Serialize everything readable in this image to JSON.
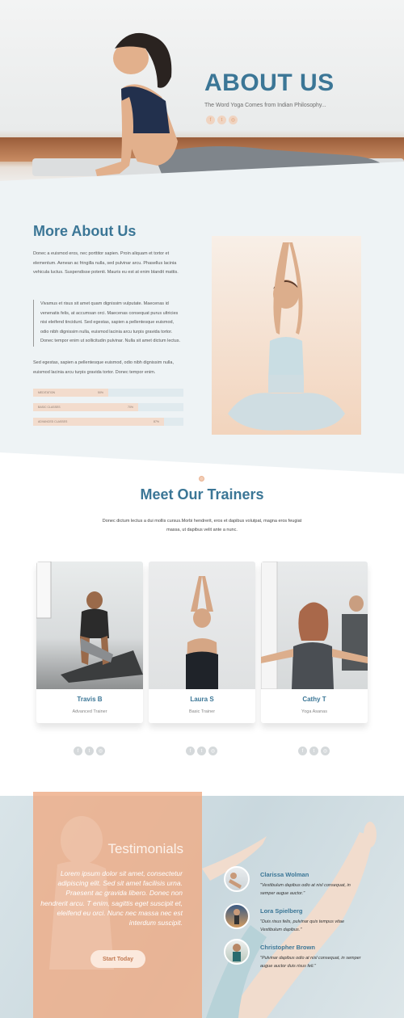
{
  "hero": {
    "title": "ABOUT US",
    "subtitle": "The Word Yoga Comes from Indian Philosophy...",
    "social_icons": [
      "facebook-icon",
      "twitter-icon",
      "instagram-icon"
    ]
  },
  "about": {
    "title": "More About Us",
    "paragraph1": "Donec a euismod eros, nec porttitor sapien. Proin aliquam et tortor et elementum. Aenean ac fringilla nulla, sed pulvinar arcu. Phasellus lacinia vehicula luctus. Suspendisse potenti. Mauris eu est at enim blandit mattis.",
    "quote": "Vivamus et risus sit amet quam dignissim vulputate. Maecenas id venenatis felis, at accumsan orci. Maecenas consequat purus ultricies nisi eleifend tincidunt. Sed egestas, sapien a pellentesque euismod, odio nibh dignissim nulla, euismod lacinia arcu turpis gravida tortor. Donec tempor enim ut sollicitudin pulvinar. Nulla sit amet dictum lectus.",
    "paragraph2": "Sed egestas, sapien a pellentesque euismod, odio nibh dignissim nulla, euismod lacinia arcu turpis gravida tortor. Donec tempor enim.",
    "skills": [
      {
        "label": "Meditation",
        "percent_text": "50%",
        "value": 0.5
      },
      {
        "label": "Basic Classes",
        "percent_text": "70%",
        "value": 0.7
      },
      {
        "label": "Advanced Classes",
        "percent_text": "87%",
        "value": 0.87
      }
    ]
  },
  "trainers": {
    "title": "Meet Our Trainers",
    "description": "Donec dictum lectus a dui mollis cursus.Morbi hendrerit, eros et dapibus volutpat, magna eros feugiat massa, ut dapibus velit ante a nunc.",
    "items": [
      {
        "name": "Travis B",
        "role": "Advanced Trainer"
      },
      {
        "name": "Laura S",
        "role": "Basic Trainer"
      },
      {
        "name": "Cathy T",
        "role": "Yoga Asanas"
      }
    ]
  },
  "testimonials": {
    "title": "Testimonials",
    "text": "Lorem ipsum dolor sit amet, consectetur adipiscing elit. Sed sit amet facilisis urna. Praesent ac gravida libero. Donec non hendrerit arcu. T enim, sagittis eget suscipit et, eleifend eu orci. Nunc nec massa nec est interdum suscipit.",
    "button": "Start Today",
    "reviews": [
      {
        "name": "Clarissa Wolman",
        "text": "\"Vestibulum dapibus odio at nisl consequat, in semper augue auctor.\""
      },
      {
        "name": "Lora Spielberg",
        "text": "\"Duis risus felis, pulvinar quis tempus vitae Vestibulum dapibus.\""
      },
      {
        "name": "Christopher Brown",
        "text": "\"Pulvinar dapibus odio at nisl consequat, in semper augue auctor duis risus feli.\""
      }
    ]
  },
  "colors": {
    "accent_blue": "#3b7696",
    "peach": "#eeac86",
    "background": "#eef3f5"
  }
}
